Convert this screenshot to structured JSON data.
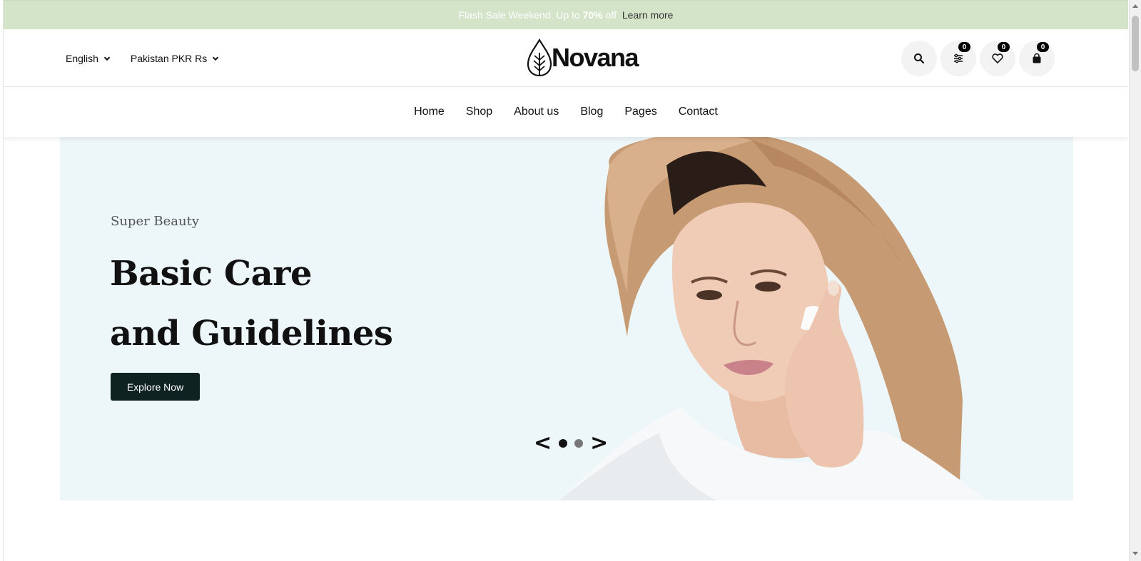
{
  "announcement": {
    "prefix": "Flash Sale Weekend. Up to ",
    "highlight": "70%",
    "suffix": " off",
    "link": "Learn more"
  },
  "header": {
    "language": "English",
    "currency": "Pakistan PKR Rs",
    "logo_text": "Novana",
    "icons": [
      {
        "name": "search-icon"
      },
      {
        "name": "compare-icon",
        "count": "0"
      },
      {
        "name": "wishlist-icon",
        "count": "0"
      },
      {
        "name": "cart-icon",
        "count": "0"
      }
    ]
  },
  "nav": {
    "items": [
      "Home",
      "Shop",
      "About us",
      "Blog",
      "Pages",
      "Contact"
    ]
  },
  "hero": {
    "subtitle": "Super Beauty",
    "title_line1": "Basic Care",
    "title_line2": "and Guidelines",
    "cta": "Explore Now",
    "prev": "<",
    "next": ">",
    "background_color": "#edf6f9",
    "button_color": "#0e2222"
  },
  "colors": {
    "announcement_bg": "#d3e4c9"
  }
}
